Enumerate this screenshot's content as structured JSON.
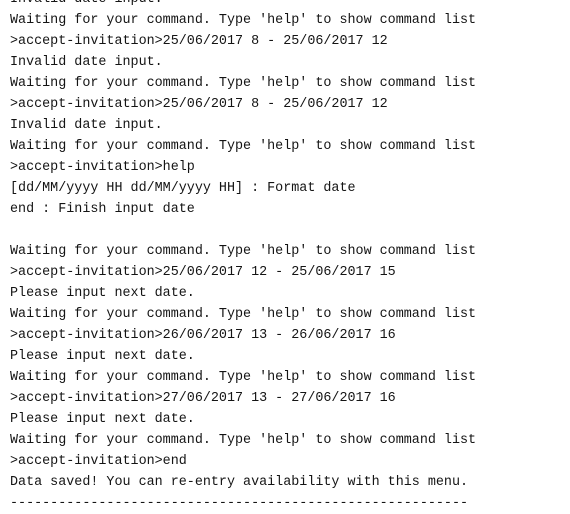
{
  "console": {
    "lines": [
      "Invalid date input.",
      "Waiting for your command. Type 'help' to show command list",
      ">accept-invitation>25/06/2017 8 - 25/06/2017 12",
      "Invalid date input.",
      "Waiting for your command. Type 'help' to show command list",
      ">accept-invitation>25/06/2017 8 - 25/06/2017 12",
      "Invalid date input.",
      "Waiting for your command. Type 'help' to show command list",
      ">accept-invitation>help",
      "[dd/MM/yyyy HH dd/MM/yyyy HH] : Format date",
      "end : Finish input date",
      "",
      "Waiting for your command. Type 'help' to show command list",
      ">accept-invitation>25/06/2017 12 - 25/06/2017 15",
      "Please input next date.",
      "Waiting for your command. Type 'help' to show command list",
      ">accept-invitation>26/06/2017 13 - 26/06/2017 16",
      "Please input next date.",
      "Waiting for your command. Type 'help' to show command list",
      ">accept-invitation>27/06/2017 13 - 27/06/2017 16",
      "Please input next date.",
      "Waiting for your command. Type 'help' to show command list",
      ">accept-invitation>end",
      "Data saved! You can re-entry availability with this menu.",
      "---------------------------------------------------------"
    ]
  }
}
